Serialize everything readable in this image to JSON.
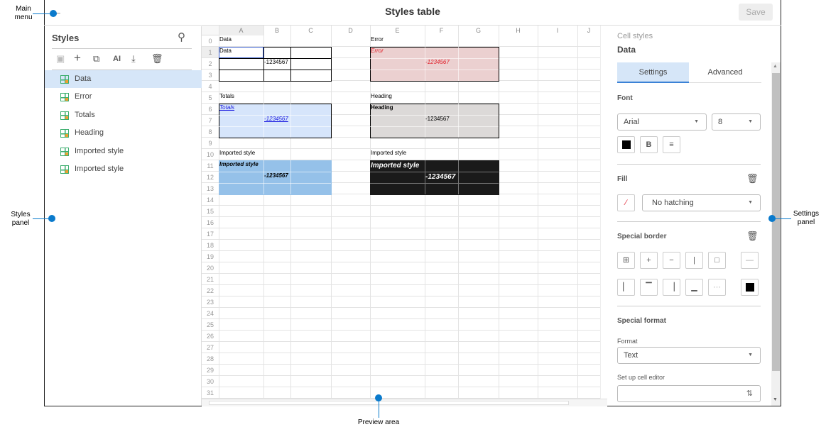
{
  "header": {
    "title": "Styles table",
    "save_label": "Save",
    "back_icon": "arrow-left-icon"
  },
  "styles_panel": {
    "title": "Styles",
    "toolbar": [
      "save-icon",
      "add-icon",
      "copy-icon",
      "ai-icon",
      "import-icon",
      "delete-icon"
    ],
    "ai_label": "AI",
    "items": [
      {
        "label": "Data",
        "selected": true
      },
      {
        "label": "Error"
      },
      {
        "label": "Totals"
      },
      {
        "label": "Heading"
      },
      {
        "label": "Imported style"
      },
      {
        "label": "Imported style"
      }
    ]
  },
  "preview": {
    "columns": [
      "A",
      "B",
      "C",
      "D",
      "E",
      "F",
      "G",
      "H",
      "I",
      "J"
    ],
    "rows": [
      "0",
      "1",
      "2",
      "3",
      "4",
      "5",
      "6",
      "7",
      "8",
      "9",
      "10",
      "11",
      "12",
      "13",
      "14",
      "15",
      "16",
      "17",
      "18",
      "19",
      "20",
      "21",
      "22",
      "23",
      "24",
      "25",
      "26",
      "27",
      "28",
      "29",
      "30",
      "31"
    ],
    "selected_cell": "A1",
    "blocks": [
      {
        "name": "data",
        "range": "A1:C3",
        "fill": "#ffffff",
        "border": "#000000",
        "gridlines": "#000000"
      },
      {
        "name": "error",
        "range": "E1:G3",
        "fill": "#ebd0d0",
        "border": "#000000"
      },
      {
        "name": "totals",
        "range": "A6:C8",
        "fill": "#d6e5fb",
        "border": "#000000"
      },
      {
        "name": "heading",
        "range": "E6:G8",
        "fill": "#dcd9d8",
        "border": "#000000"
      },
      {
        "name": "imported1",
        "range": "A11:C13",
        "fill": "#95c1e9"
      },
      {
        "name": "imported2",
        "range": "E11:G13",
        "fill": "#1a1a1a"
      }
    ],
    "cells": [
      {
        "ref": "A0",
        "text": "Data"
      },
      {
        "ref": "E0",
        "text": "Error"
      },
      {
        "ref": "A1",
        "text": "Data"
      },
      {
        "ref": "B2",
        "text": "-1234567"
      },
      {
        "ref": "E1",
        "text": "Error",
        "style": "italic",
        "color": "#e0202a"
      },
      {
        "ref": "F2",
        "text": "-1234567",
        "style": "italic",
        "color": "#e0202a"
      },
      {
        "ref": "A5",
        "text": "Totals"
      },
      {
        "ref": "E5",
        "text": "Heading"
      },
      {
        "ref": "A6",
        "text": "Totals",
        "style": "italic underline",
        "color": "#1a1ae0"
      },
      {
        "ref": "B7",
        "text": "-1234567",
        "style": "italic underline",
        "color": "#1a1ae0"
      },
      {
        "ref": "E6",
        "text": "Heading",
        "style": "bold",
        "color": "#000000"
      },
      {
        "ref": "F7",
        "text": "-1234567",
        "color": "#000000"
      },
      {
        "ref": "A10",
        "text": "Imported style"
      },
      {
        "ref": "E10",
        "text": "Imported style"
      },
      {
        "ref": "A11",
        "text": "Imported style",
        "style": "italic bold",
        "color": "#000000"
      },
      {
        "ref": "B12",
        "text": "-1234567",
        "style": "italic bold",
        "color": "#000000"
      },
      {
        "ref": "E11",
        "text": "Imported style",
        "style": "italic bold big",
        "color": "#ffffff"
      },
      {
        "ref": "F12",
        "text": "-1234567",
        "style": "italic bold big",
        "color": "#ffffff"
      }
    ]
  },
  "settings": {
    "section_title": "Cell styles",
    "style_name": "Data",
    "tabs": [
      {
        "label": "Settings",
        "active": true
      },
      {
        "label": "Advanced"
      }
    ],
    "font": {
      "title": "Font",
      "family": "Arial",
      "size": "8",
      "color": "#000000",
      "bold_label": "B"
    },
    "fill": {
      "title": "Fill",
      "hatching": "No hatching"
    },
    "border": {
      "title": "Special border",
      "color": "#000000"
    },
    "format": {
      "title": "Special format",
      "format_label": "Format",
      "format_value": "Text",
      "editor_label": "Set up cell editor"
    }
  },
  "callouts": {
    "main_menu": "Main menu",
    "styles_panel": "Styles panel",
    "settings_panel": "Settings panel",
    "preview_area": "Preview area"
  }
}
